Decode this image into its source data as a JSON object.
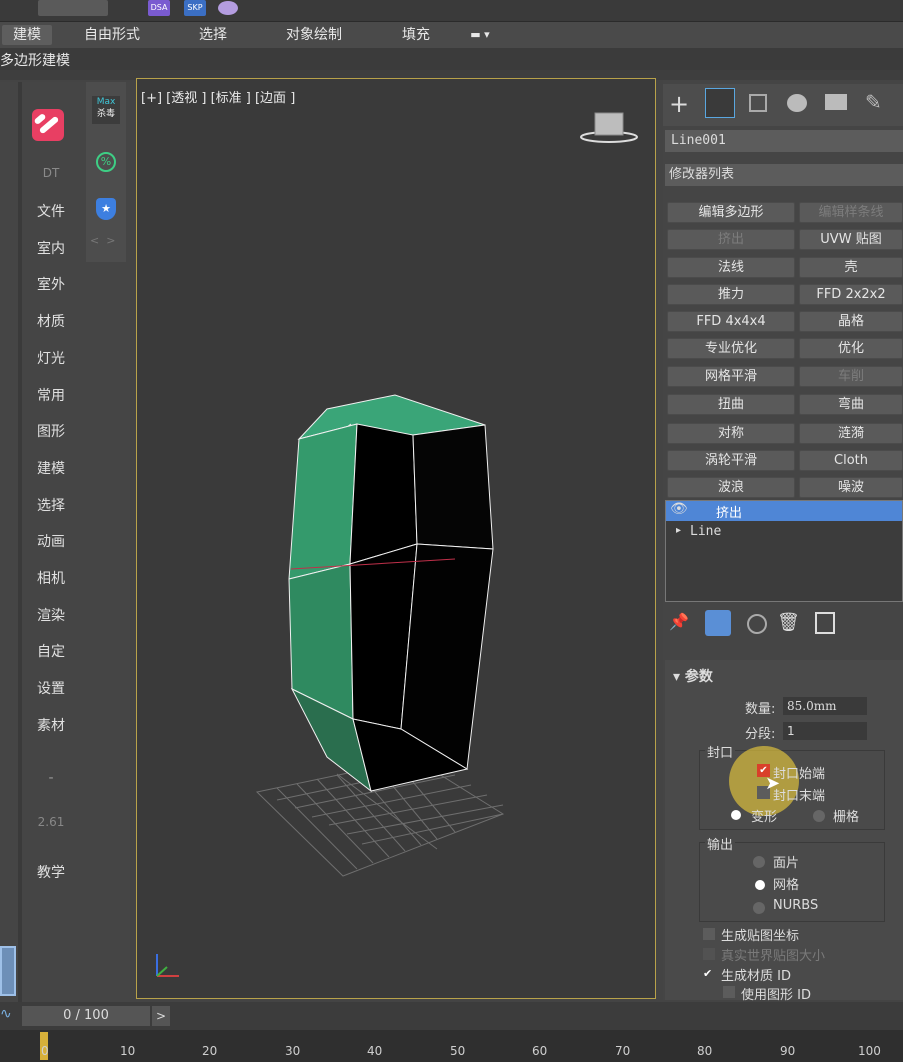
{
  "ribbon": {
    "tabs": [
      "建模",
      "自由形式",
      "选择",
      "对象绘制",
      "填充"
    ],
    "active": "建模"
  },
  "subtitle": "多边形建模",
  "topbar": {
    "icons": [
      "DSA",
      "SKP"
    ]
  },
  "left_panel": {
    "max_label": "Max",
    "max_sub": "杀毒",
    "dt": "DT",
    "menu": [
      "文件",
      "室内",
      "室外",
      "材质",
      "灯光",
      "常用",
      "图形",
      "建模",
      "选择",
      "动画",
      "相机",
      "渲染",
      "自定",
      "设置",
      "素材"
    ],
    "dash": "-",
    "version": "2.61",
    "teach": "教学"
  },
  "viewport": {
    "label": "[+] [透视 ] [标准 ] [边面 ]"
  },
  "command_panel": {
    "object_name": "Line001",
    "modifier_list": "修改器列表",
    "buttons": [
      [
        "编辑多边形",
        "编辑样条线"
      ],
      [
        "挤出",
        "UVW 贴图"
      ],
      [
        "法线",
        "壳"
      ],
      [
        "推力",
        "FFD 2x2x2"
      ],
      [
        "FFD 4x4x4",
        "晶格"
      ],
      [
        "专业优化",
        "优化"
      ],
      [
        "网格平滑",
        "车削"
      ],
      [
        "扭曲",
        "弯曲"
      ],
      [
        "对称",
        "涟漪"
      ],
      [
        "涡轮平滑",
        "Cloth"
      ],
      [
        "波浪",
        "噪波"
      ]
    ],
    "stack": [
      "挤出",
      "Line"
    ],
    "params_title": "参数",
    "amount_label": "数量:",
    "amount_value": "85.0mm",
    "segments_label": "分段:",
    "segments_value": "1",
    "cap_group": "封口",
    "cap_start": "封口始端",
    "cap_end": "封口末端",
    "morph": "变形",
    "grid": "栅格",
    "output_group": "输出",
    "patch": "面片",
    "mesh": "网格",
    "nurbs": "NURBS",
    "gen_map": "生成贴图坐标",
    "real_world": "真实世界贴图大小",
    "gen_mat": "生成材质 ID",
    "use_shape": "使用图形 ID"
  },
  "timeline": {
    "frame": "0 / 100",
    "ticks": [
      "0",
      "10",
      "20",
      "30",
      "40",
      "50",
      "60",
      "70",
      "80",
      "90",
      "100"
    ]
  }
}
